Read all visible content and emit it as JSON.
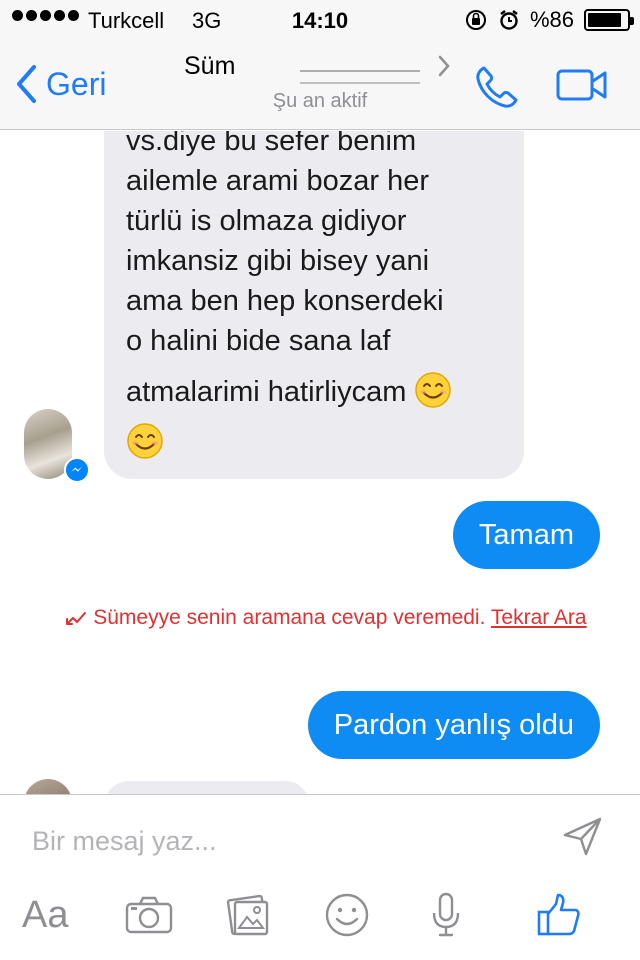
{
  "status_bar": {
    "carrier": "Turkcell",
    "network": "3G",
    "time": "14:10",
    "battery_percent": "%86",
    "battery_level": 0.86
  },
  "nav": {
    "back_label": "Geri",
    "contact_name": "Süm",
    "contact_status": "Şu an aktif",
    "name_chevron": "›"
  },
  "conversation": {
    "incoming": {
      "lines": [
        "vs.diye bu sefer benim",
        "ailemle arami bozar her",
        "türlü is olmaza gidiyor",
        "imkansiz gibi bisey yani",
        "ama ben hep konserdeki",
        "o halini bide sana laf",
        "atmalarimi hatirliycam"
      ]
    },
    "outgoing_1": "Tamam",
    "missed_call": {
      "text": "Sümeyye senin aramana cevap veremedi.",
      "action": "Tekrar Ara"
    },
    "outgoing_2": "Pardon yanlış oldu"
  },
  "composer": {
    "placeholder": "Bir mesaj yaz...",
    "aa_label": "Aa"
  },
  "colors": {
    "accent": "#1f7cf6",
    "outgoing_bubble": "#0f8bf4",
    "incoming_bubble": "#ececf0",
    "missed_call": "#e03131",
    "icon_gray": "#8e8e93"
  },
  "icons": [
    "back-chevron-icon",
    "phone-icon",
    "video-camera-icon",
    "messenger-badge-icon",
    "missed-call-arrow-icon",
    "send-icon",
    "camera-icon",
    "photo-gallery-icon",
    "emoji-icon",
    "microphone-icon",
    "thumbs-up-icon"
  ]
}
